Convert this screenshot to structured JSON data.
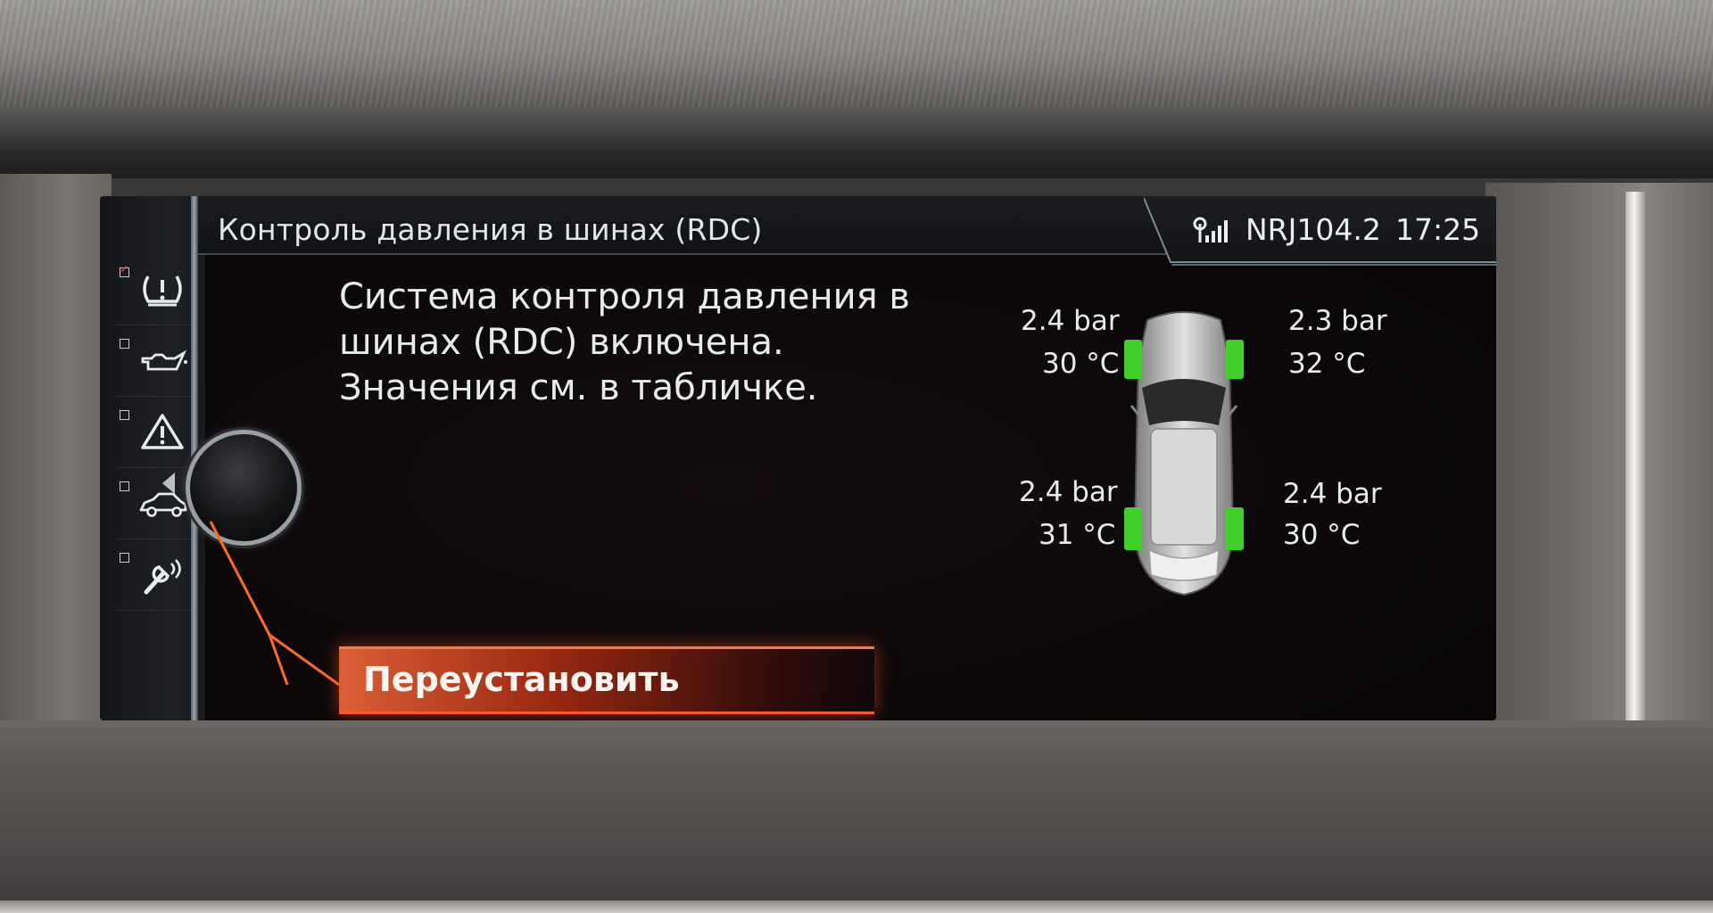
{
  "header": {
    "title": "Контроль давления в шинах (RDC)",
    "station": "NRJ104.2",
    "time": "17:25"
  },
  "sidebar": {
    "items": [
      {
        "icon": "tire-pressure-warning-icon",
        "checked": true
      },
      {
        "icon": "oil-can-icon",
        "checked": false
      },
      {
        "icon": "warning-triangle-icon",
        "checked": false
      },
      {
        "icon": "car-icon",
        "checked": false
      },
      {
        "icon": "wrench-wireless-icon",
        "checked": false
      }
    ]
  },
  "message": {
    "line1": "Система контроля давления в",
    "line2": "шинах (RDC) включена.",
    "line3": "Значения см. в табличке."
  },
  "actions": {
    "reset_label": "Переустановить"
  },
  "tires": {
    "front_left": {
      "pressure": "2.4 bar",
      "temperature": "30 °C"
    },
    "front_right": {
      "pressure": "2.3 bar",
      "temperature": "32 °C"
    },
    "rear_left": {
      "pressure": "2.4 bar",
      "temperature": "31 °C"
    },
    "rear_right": {
      "pressure": "2.4 bar",
      "temperature": "30 °C"
    }
  },
  "colors": {
    "tire_ok": "#3fd12a",
    "selection": "#ff5a20",
    "text": "#e6ecee"
  }
}
